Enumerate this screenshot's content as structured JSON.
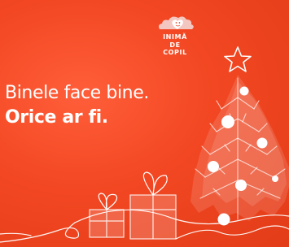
{
  "logo": {
    "line1": "INIMĂ",
    "line2": "DE COPIL"
  },
  "headline": {
    "line1": "Binele face bine.",
    "line2": "Orice ar fi."
  },
  "colors": {
    "background": "#f24722",
    "foreground": "#ffffff"
  }
}
